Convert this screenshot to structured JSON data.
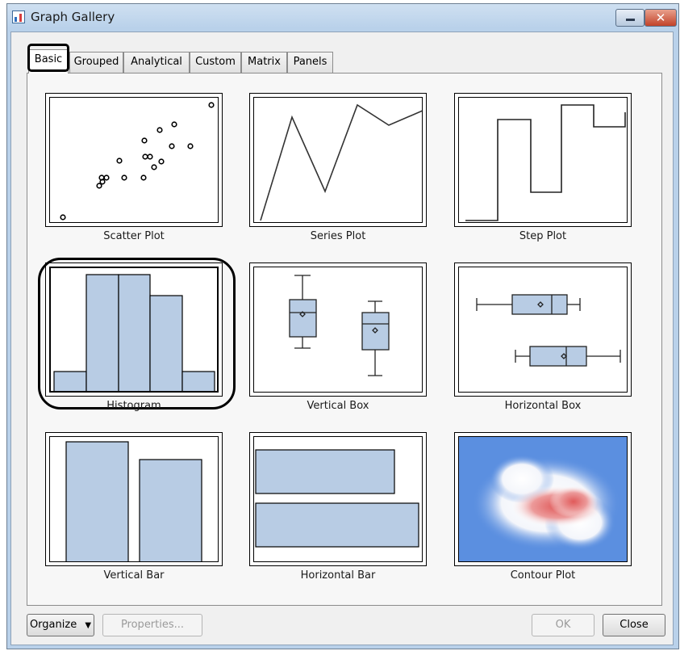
{
  "window": {
    "title": "Graph Gallery"
  },
  "tabs": [
    {
      "label": "Basic",
      "active": true
    },
    {
      "label": "Grouped"
    },
    {
      "label": "Analytical"
    },
    {
      "label": "Custom"
    },
    {
      "label": "Matrix"
    },
    {
      "label": "Panels"
    }
  ],
  "gallery": [
    {
      "label": "Scatter Plot"
    },
    {
      "label": "Series Plot"
    },
    {
      "label": "Step Plot"
    },
    {
      "label": "Histogram",
      "selected": true
    },
    {
      "label": "Vertical Box"
    },
    {
      "label": "Horizontal Box"
    },
    {
      "label": "Vertical Bar"
    },
    {
      "label": "Horizontal Bar"
    },
    {
      "label": "Contour Plot"
    }
  ],
  "buttons": {
    "organize": "Organize",
    "properties": "Properties...",
    "ok": "OK",
    "close": "Close"
  },
  "colors": {
    "bar_fill": "#b8cce4",
    "contour_bg": "#5b8fe0",
    "contour_hot": "#e05a5a"
  }
}
